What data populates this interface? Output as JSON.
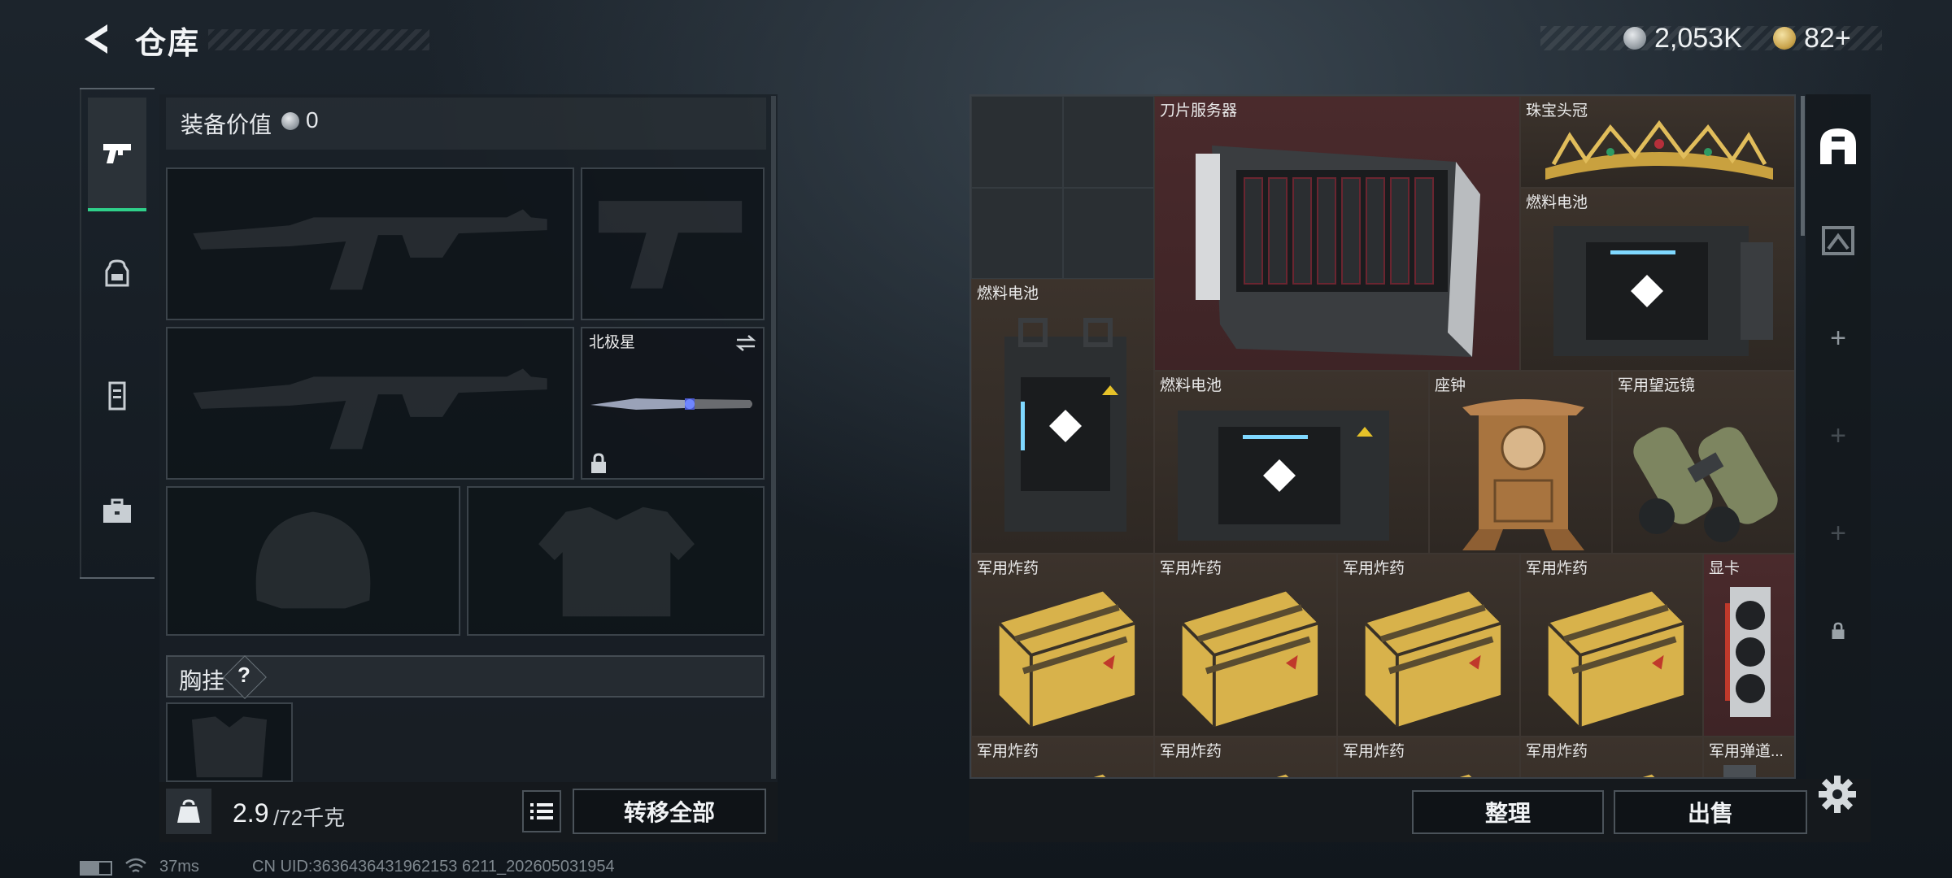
{
  "header": {
    "title": "仓库",
    "currency_silver": "2,053K",
    "currency_gold": "82+"
  },
  "equipment": {
    "value_label": "装备价值",
    "value": "0",
    "melee_name": "北极星",
    "chest_label": "胸挂",
    "chest_help": "?",
    "weight_current": "2.9",
    "weight_max": "/72千克",
    "transfer_all": "转移全部"
  },
  "storage": {
    "items": [
      {
        "label": "刀片服务器",
        "icon": "blade-server"
      },
      {
        "label": "珠宝头冠",
        "icon": "jeweled-crown"
      },
      {
        "label": "燃料电池",
        "icon": "fuel-cell"
      },
      {
        "label": "燃料电池",
        "icon": "fuel-cell"
      },
      {
        "label": "燃料电池",
        "icon": "fuel-cell"
      },
      {
        "label": "座钟",
        "icon": "mantel-clock"
      },
      {
        "label": "军用望远镜",
        "icon": "binoculars"
      },
      {
        "label": "军用炸药",
        "icon": "explosive-crate"
      },
      {
        "label": "军用炸药",
        "icon": "explosive-crate"
      },
      {
        "label": "军用炸药",
        "icon": "explosive-crate"
      },
      {
        "label": "军用炸药",
        "icon": "explosive-crate"
      },
      {
        "label": "显卡",
        "icon": "graphics-card"
      },
      {
        "label": "军用炸药",
        "icon": "explosive-crate"
      },
      {
        "label": "军用炸药",
        "icon": "explosive-crate"
      },
      {
        "label": "军用炸药",
        "icon": "explosive-crate"
      },
      {
        "label": "军用炸药",
        "icon": "explosive-crate"
      },
      {
        "label": "军用弹道...",
        "icon": "ballistic-item"
      }
    ],
    "sort_button": "整理",
    "sell_button": "出售"
  },
  "status_bar": {
    "ping": "37ms",
    "uid": "CN UID:3636436431962153 6211_202605031954"
  },
  "colors": {
    "accent_green": "#2fd08a",
    "item_bg_brown": "#3c332c",
    "item_bg_red": "#4a2a2c",
    "button_bg": "#0f1317"
  }
}
